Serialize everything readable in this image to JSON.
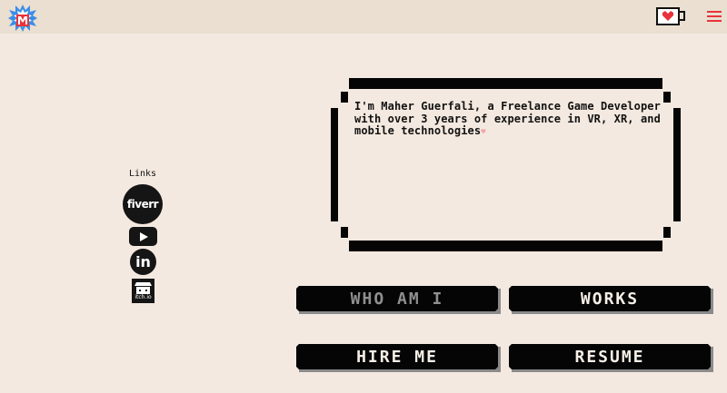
{
  "header": {
    "logo_icon": "pixel-m-logo-icon",
    "coffee_icon": "coffee-cup-heart-icon",
    "menu_icon": "hamburger-menu-icon"
  },
  "links": {
    "title": "Links",
    "items": [
      {
        "name": "fiverr",
        "label": "fiverr"
      },
      {
        "name": "youtube",
        "icon": "youtube-play-icon"
      },
      {
        "name": "linkedin",
        "label": "in"
      },
      {
        "name": "itchio",
        "label": "itch.io"
      }
    ]
  },
  "dialog": {
    "text": "I'm Maher Guerfali, a Freelance Game Developer with over 3 years of experience in VR, XR, and mobile technologies",
    "cursor": "♥"
  },
  "buttons": {
    "who_am_i": "WHO AM I",
    "works": "WORKS",
    "hire_me": "HIRE ME",
    "resume": "RESUME"
  },
  "colors": {
    "background": "#f4e9e0",
    "header": "#eadfd0",
    "button": "#050505",
    "accent_red": "#e8333a"
  }
}
